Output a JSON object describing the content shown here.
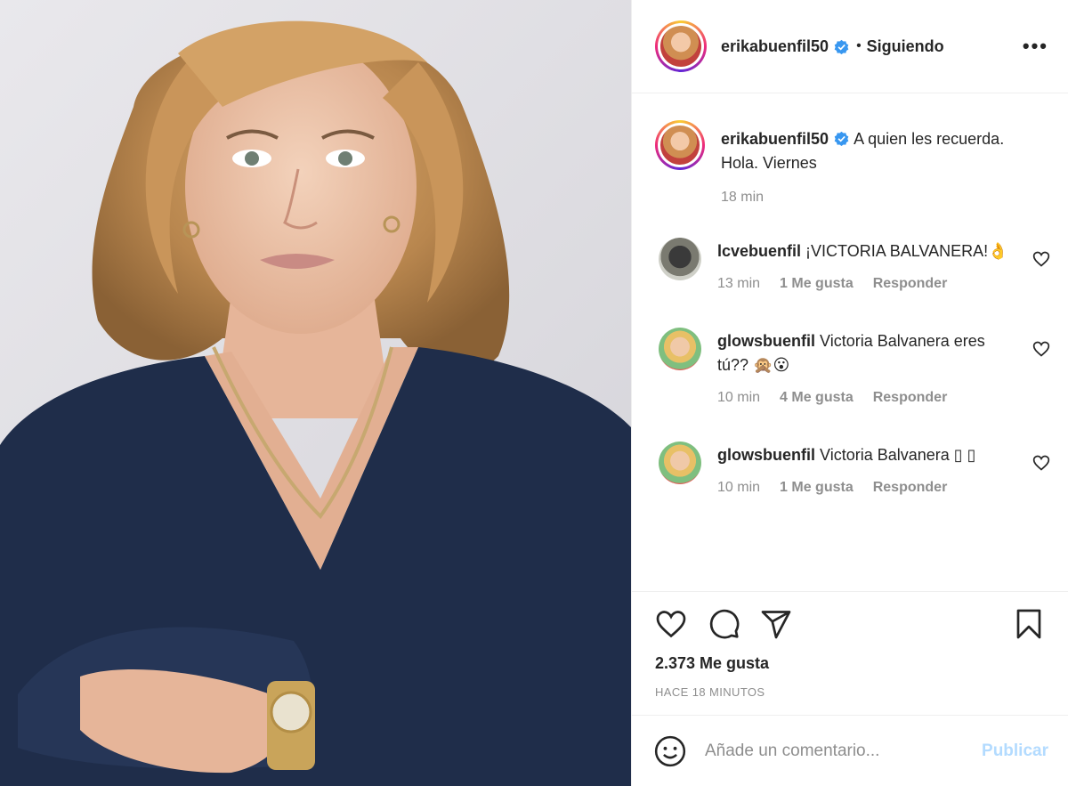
{
  "post": {
    "username": "erikabuenfil50",
    "verified_icon": "verified-badge-icon",
    "separator": "•",
    "follow_status": "Siguiendo",
    "more_label": "•••",
    "caption": "A quien les recuerda. Hola. Viernes",
    "caption_time": "18 min",
    "likes": "2.373 Me gusta",
    "posted_ago": "HACE 18 MINUTOS"
  },
  "comments": [
    {
      "username": "lcvebuenfil",
      "text": "¡VICTORIA BALVANERA!👌",
      "time": "13 min",
      "likes": "1 Me gusta",
      "reply": "Responder"
    },
    {
      "username": "glowsbuenfil",
      "text": "Victoria Balvanera eres tú?? 🙊😮",
      "time": "10 min",
      "likes": "4 Me gusta",
      "reply": "Responder"
    },
    {
      "username": "glowsbuenfil",
      "text": "Victoria Balvanera ▯ ▯",
      "time": "10 min",
      "likes": "1 Me gusta",
      "reply": "Responder"
    }
  ],
  "composer": {
    "placeholder": "Añade un comentario...",
    "publish_label": "Publicar",
    "emoji_icon": "smiley-icon"
  },
  "colors": {
    "link_disabled": "#b3dbff",
    "muted": "#8e8e8e",
    "verified": "#3897f0"
  }
}
